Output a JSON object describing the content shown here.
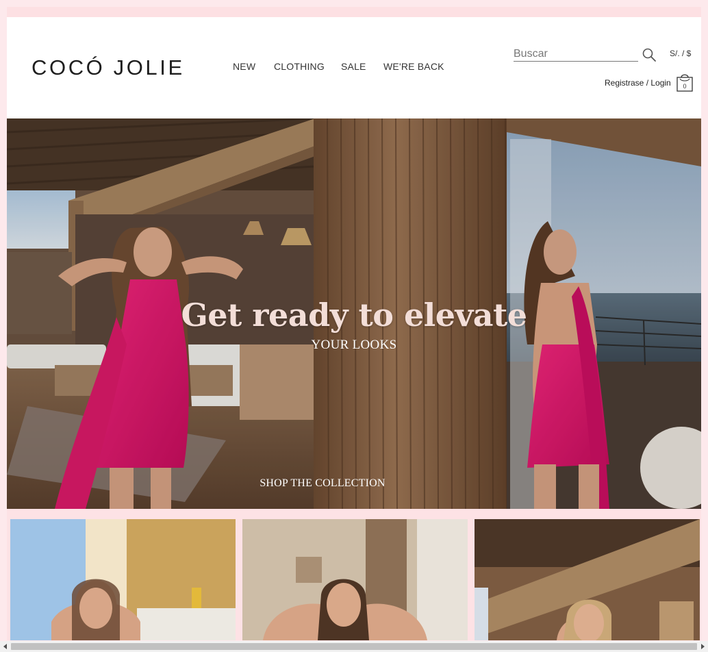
{
  "brand": {
    "logo_text": "COCÓ JOLIE"
  },
  "nav": {
    "items": [
      "NEW",
      "CLOTHING",
      "SALE",
      "WE'RE BACK"
    ]
  },
  "header": {
    "search_placeholder": "Buscar",
    "currency": "S/. / $",
    "login": "Registrase / Login",
    "cart_count": "0"
  },
  "hero": {
    "title": "Get ready to elevate",
    "subtitle": "YOUR LOOKS",
    "cta": "SHOP THE COLLECTION"
  },
  "colors": {
    "page_bg": "#fde9ec",
    "accent_pink": "#e0186f",
    "hero_title": "#f3ded8"
  }
}
